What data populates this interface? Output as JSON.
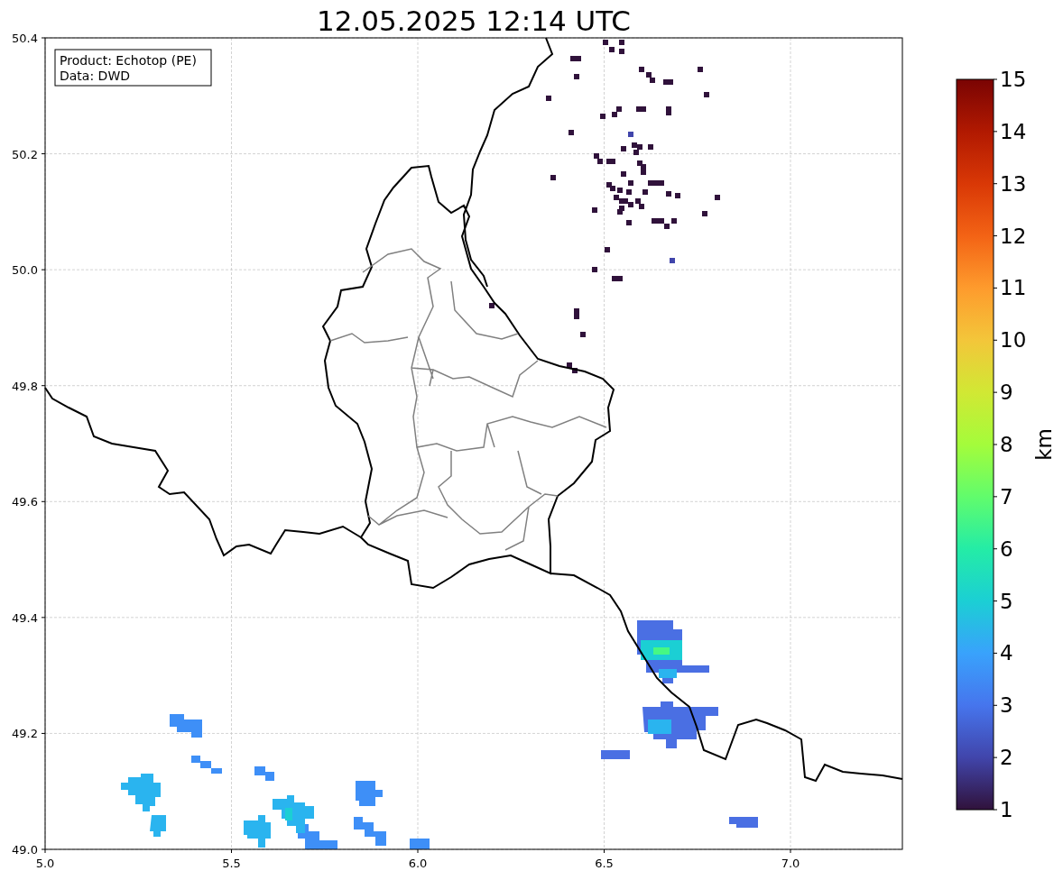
{
  "title": "12.05.2025 12:14 UTC",
  "info_box": [
    "Product: Echotop (PE)",
    "Data: DWD"
  ],
  "x_axis": {
    "ticks": [
      "5.0",
      "5.5",
      "6.0",
      "6.5",
      "7.0"
    ]
  },
  "y_axis": {
    "ticks": [
      "50.4",
      "50.2",
      "50.0",
      "49.8",
      "49.6",
      "49.4",
      "49.2",
      "49.0"
    ]
  },
  "colorbar": {
    "label": "km",
    "ticks": [
      "15",
      "14",
      "13",
      "12",
      "11",
      "10",
      "9",
      "8",
      "7",
      "6",
      "5",
      "4",
      "3",
      "2",
      "1"
    ]
  }
}
